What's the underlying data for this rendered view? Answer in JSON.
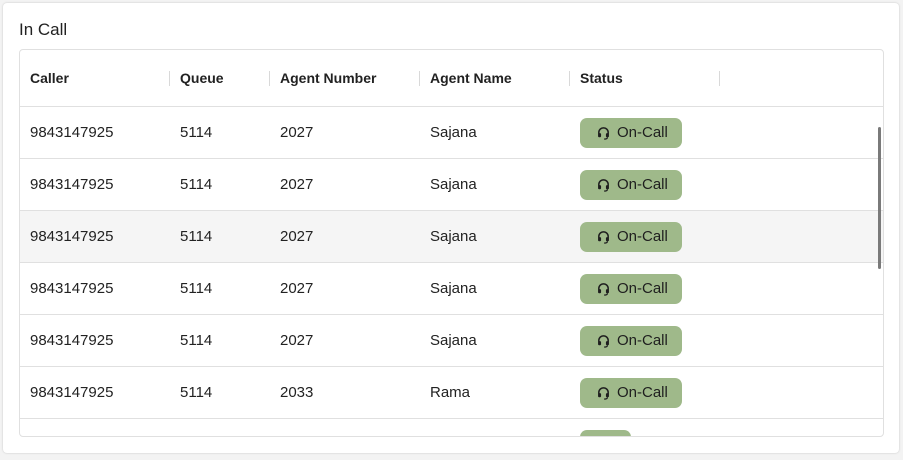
{
  "panel": {
    "title": "In Call"
  },
  "table": {
    "columns": [
      "Caller",
      "Queue",
      "Agent Number",
      "Agent Name",
      "Status"
    ],
    "rows": [
      {
        "caller": "9843147925",
        "queue": "5114",
        "agent_number": "2027",
        "agent_name": "Sajana",
        "status": "On-Call"
      },
      {
        "caller": "9843147925",
        "queue": "5114",
        "agent_number": "2027",
        "agent_name": "Sajana",
        "status": "On-Call"
      },
      {
        "caller": "9843147925",
        "queue": "5114",
        "agent_number": "2027",
        "agent_name": "Sajana",
        "status": "On-Call"
      },
      {
        "caller": "9843147925",
        "queue": "5114",
        "agent_number": "2027",
        "agent_name": "Sajana",
        "status": "On-Call"
      },
      {
        "caller": "9843147925",
        "queue": "5114",
        "agent_number": "2027",
        "agent_name": "Sajana",
        "status": "On-Call"
      },
      {
        "caller": "9843147925",
        "queue": "5114",
        "agent_number": "2033",
        "agent_name": "Rama",
        "status": "On-Call"
      },
      {
        "caller": "",
        "queue": "",
        "agent_number": "",
        "agent_name": "",
        "status": ""
      }
    ]
  },
  "colors": {
    "status_chip_bg": "#9fb98a",
    "row_hover_bg": "#f5f5f5"
  },
  "icons": {
    "status": "headset-icon"
  }
}
